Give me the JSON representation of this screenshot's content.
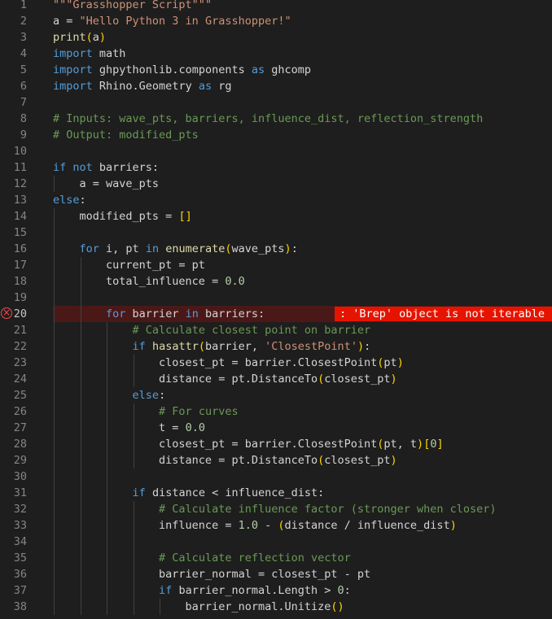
{
  "editor": {
    "error": {
      "line": 20,
      "message": ": 'Brep' object is not iterable"
    },
    "lines": [
      {
        "n": "1",
        "indent": 0,
        "t": [
          [
            "str",
            "\"\"\"Grasshopper Script\"\"\""
          ]
        ]
      },
      {
        "n": "2",
        "indent": 0,
        "t": [
          [
            "plain",
            "a = "
          ],
          [
            "str",
            "\"Hello Python 3 in Grasshopper!\""
          ]
        ]
      },
      {
        "n": "3",
        "indent": 0,
        "t": [
          [
            "fn",
            "print"
          ],
          [
            "br1",
            "("
          ],
          [
            "plain",
            "a"
          ],
          [
            "br1",
            ")"
          ]
        ]
      },
      {
        "n": "4",
        "indent": 0,
        "t": [
          [
            "kw",
            "import"
          ],
          [
            "plain",
            " math"
          ]
        ]
      },
      {
        "n": "5",
        "indent": 0,
        "t": [
          [
            "kw",
            "import"
          ],
          [
            "plain",
            " ghpythonlib.components "
          ],
          [
            "kw",
            "as"
          ],
          [
            "plain",
            " ghcomp"
          ]
        ]
      },
      {
        "n": "6",
        "indent": 0,
        "t": [
          [
            "kw",
            "import"
          ],
          [
            "plain",
            " Rhino.Geometry "
          ],
          [
            "kw",
            "as"
          ],
          [
            "plain",
            " rg"
          ]
        ]
      },
      {
        "n": "7",
        "indent": 0,
        "t": []
      },
      {
        "n": "8",
        "indent": 0,
        "t": [
          [
            "cm",
            "# Inputs: wave_pts, barriers, influence_dist, reflection_strength"
          ]
        ]
      },
      {
        "n": "9",
        "indent": 0,
        "t": [
          [
            "cm",
            "# Output: modified_pts"
          ]
        ]
      },
      {
        "n": "10",
        "indent": 0,
        "t": []
      },
      {
        "n": "11",
        "indent": 0,
        "t": [
          [
            "kw",
            "if not"
          ],
          [
            "plain",
            " barriers:"
          ]
        ]
      },
      {
        "n": "12",
        "indent": 1,
        "t": [
          [
            "plain",
            "    a = wave_pts"
          ]
        ]
      },
      {
        "n": "13",
        "indent": 0,
        "t": [
          [
            "kw",
            "else"
          ],
          [
            "plain",
            ":"
          ]
        ]
      },
      {
        "n": "14",
        "indent": 1,
        "t": [
          [
            "plain",
            "    modified_pts = "
          ],
          [
            "br1",
            "[]"
          ]
        ]
      },
      {
        "n": "15",
        "indent": 1,
        "t": []
      },
      {
        "n": "16",
        "indent": 1,
        "t": [
          [
            "plain",
            "    "
          ],
          [
            "kw",
            "for"
          ],
          [
            "plain",
            " i, pt "
          ],
          [
            "kw",
            "in"
          ],
          [
            "plain",
            " "
          ],
          [
            "fn",
            "enumerate"
          ],
          [
            "br1",
            "("
          ],
          [
            "plain",
            "wave_pts"
          ],
          [
            "br1",
            ")"
          ],
          [
            "plain",
            ":"
          ]
        ]
      },
      {
        "n": "17",
        "indent": 2,
        "t": [
          [
            "plain",
            "        current_pt = pt"
          ]
        ]
      },
      {
        "n": "18",
        "indent": 2,
        "t": [
          [
            "plain",
            "        total_influence = "
          ],
          [
            "num",
            "0.0"
          ]
        ]
      },
      {
        "n": "19",
        "indent": 2,
        "t": []
      },
      {
        "n": "20",
        "indent": 2,
        "t": [
          [
            "plain",
            "        "
          ],
          [
            "kw",
            "for"
          ],
          [
            "plain",
            " barrier "
          ],
          [
            "kw",
            "in"
          ],
          [
            "plain",
            " barriers:"
          ]
        ]
      },
      {
        "n": "21",
        "indent": 3,
        "t": [
          [
            "plain",
            "            "
          ],
          [
            "cm",
            "# Calculate closest point on barrier"
          ]
        ]
      },
      {
        "n": "22",
        "indent": 3,
        "t": [
          [
            "plain",
            "            "
          ],
          [
            "kw",
            "if"
          ],
          [
            "plain",
            " "
          ],
          [
            "fn",
            "hasattr"
          ],
          [
            "br1",
            "("
          ],
          [
            "plain",
            "barrier, "
          ],
          [
            "str",
            "'ClosestPoint'"
          ],
          [
            "br1",
            ")"
          ],
          [
            "plain",
            ":"
          ]
        ]
      },
      {
        "n": "23",
        "indent": 4,
        "t": [
          [
            "plain",
            "                closest_pt = barrier."
          ],
          [
            "plain",
            "ClosestPoint"
          ],
          [
            "br1",
            "("
          ],
          [
            "plain",
            "pt"
          ],
          [
            "br1",
            ")"
          ]
        ]
      },
      {
        "n": "24",
        "indent": 4,
        "t": [
          [
            "plain",
            "                distance = pt."
          ],
          [
            "plain",
            "DistanceTo"
          ],
          [
            "br1",
            "("
          ],
          [
            "plain",
            "closest_pt"
          ],
          [
            "br1",
            ")"
          ]
        ]
      },
      {
        "n": "25",
        "indent": 3,
        "t": [
          [
            "plain",
            "            "
          ],
          [
            "kw",
            "else"
          ],
          [
            "plain",
            ":"
          ]
        ]
      },
      {
        "n": "26",
        "indent": 4,
        "t": [
          [
            "plain",
            "                "
          ],
          [
            "cm",
            "# For curves"
          ]
        ]
      },
      {
        "n": "27",
        "indent": 4,
        "t": [
          [
            "plain",
            "                t = "
          ],
          [
            "num",
            "0.0"
          ]
        ]
      },
      {
        "n": "28",
        "indent": 4,
        "t": [
          [
            "plain",
            "                closest_pt = barrier.ClosestPoint"
          ],
          [
            "br1",
            "("
          ],
          [
            "plain",
            "pt, t"
          ],
          [
            "br1",
            ")"
          ],
          [
            "br1",
            "["
          ],
          [
            "num",
            "0"
          ],
          [
            "br1",
            "]"
          ]
        ]
      },
      {
        "n": "29",
        "indent": 4,
        "t": [
          [
            "plain",
            "                distance = pt.DistanceTo"
          ],
          [
            "br1",
            "("
          ],
          [
            "plain",
            "closest_pt"
          ],
          [
            "br1",
            ")"
          ]
        ]
      },
      {
        "n": "30",
        "indent": 3,
        "t": []
      },
      {
        "n": "31",
        "indent": 3,
        "t": [
          [
            "plain",
            "            "
          ],
          [
            "kw",
            "if"
          ],
          [
            "plain",
            " distance < influence_dist:"
          ]
        ]
      },
      {
        "n": "32",
        "indent": 4,
        "t": [
          [
            "plain",
            "                "
          ],
          [
            "cm",
            "# Calculate influence factor (stronger when closer)"
          ]
        ]
      },
      {
        "n": "33",
        "indent": 4,
        "t": [
          [
            "plain",
            "                influence = "
          ],
          [
            "num",
            "1.0"
          ],
          [
            "plain",
            " - "
          ],
          [
            "br1",
            "("
          ],
          [
            "plain",
            "distance / influence_dist"
          ],
          [
            "br1",
            ")"
          ]
        ]
      },
      {
        "n": "34",
        "indent": 4,
        "t": []
      },
      {
        "n": "35",
        "indent": 4,
        "t": [
          [
            "plain",
            "                "
          ],
          [
            "cm",
            "# Calculate reflection vector"
          ]
        ]
      },
      {
        "n": "36",
        "indent": 4,
        "t": [
          [
            "plain",
            "                barrier_normal = closest_pt - pt"
          ]
        ]
      },
      {
        "n": "37",
        "indent": 4,
        "t": [
          [
            "plain",
            "                "
          ],
          [
            "kw",
            "if"
          ],
          [
            "plain",
            " barrier_normal.Length > "
          ],
          [
            "num",
            "0"
          ],
          [
            "plain",
            ":"
          ]
        ]
      },
      {
        "n": "38",
        "indent": 5,
        "t": [
          [
            "plain",
            "                    barrier_normal.Unitize"
          ],
          [
            "br1",
            "()"
          ]
        ]
      }
    ]
  }
}
